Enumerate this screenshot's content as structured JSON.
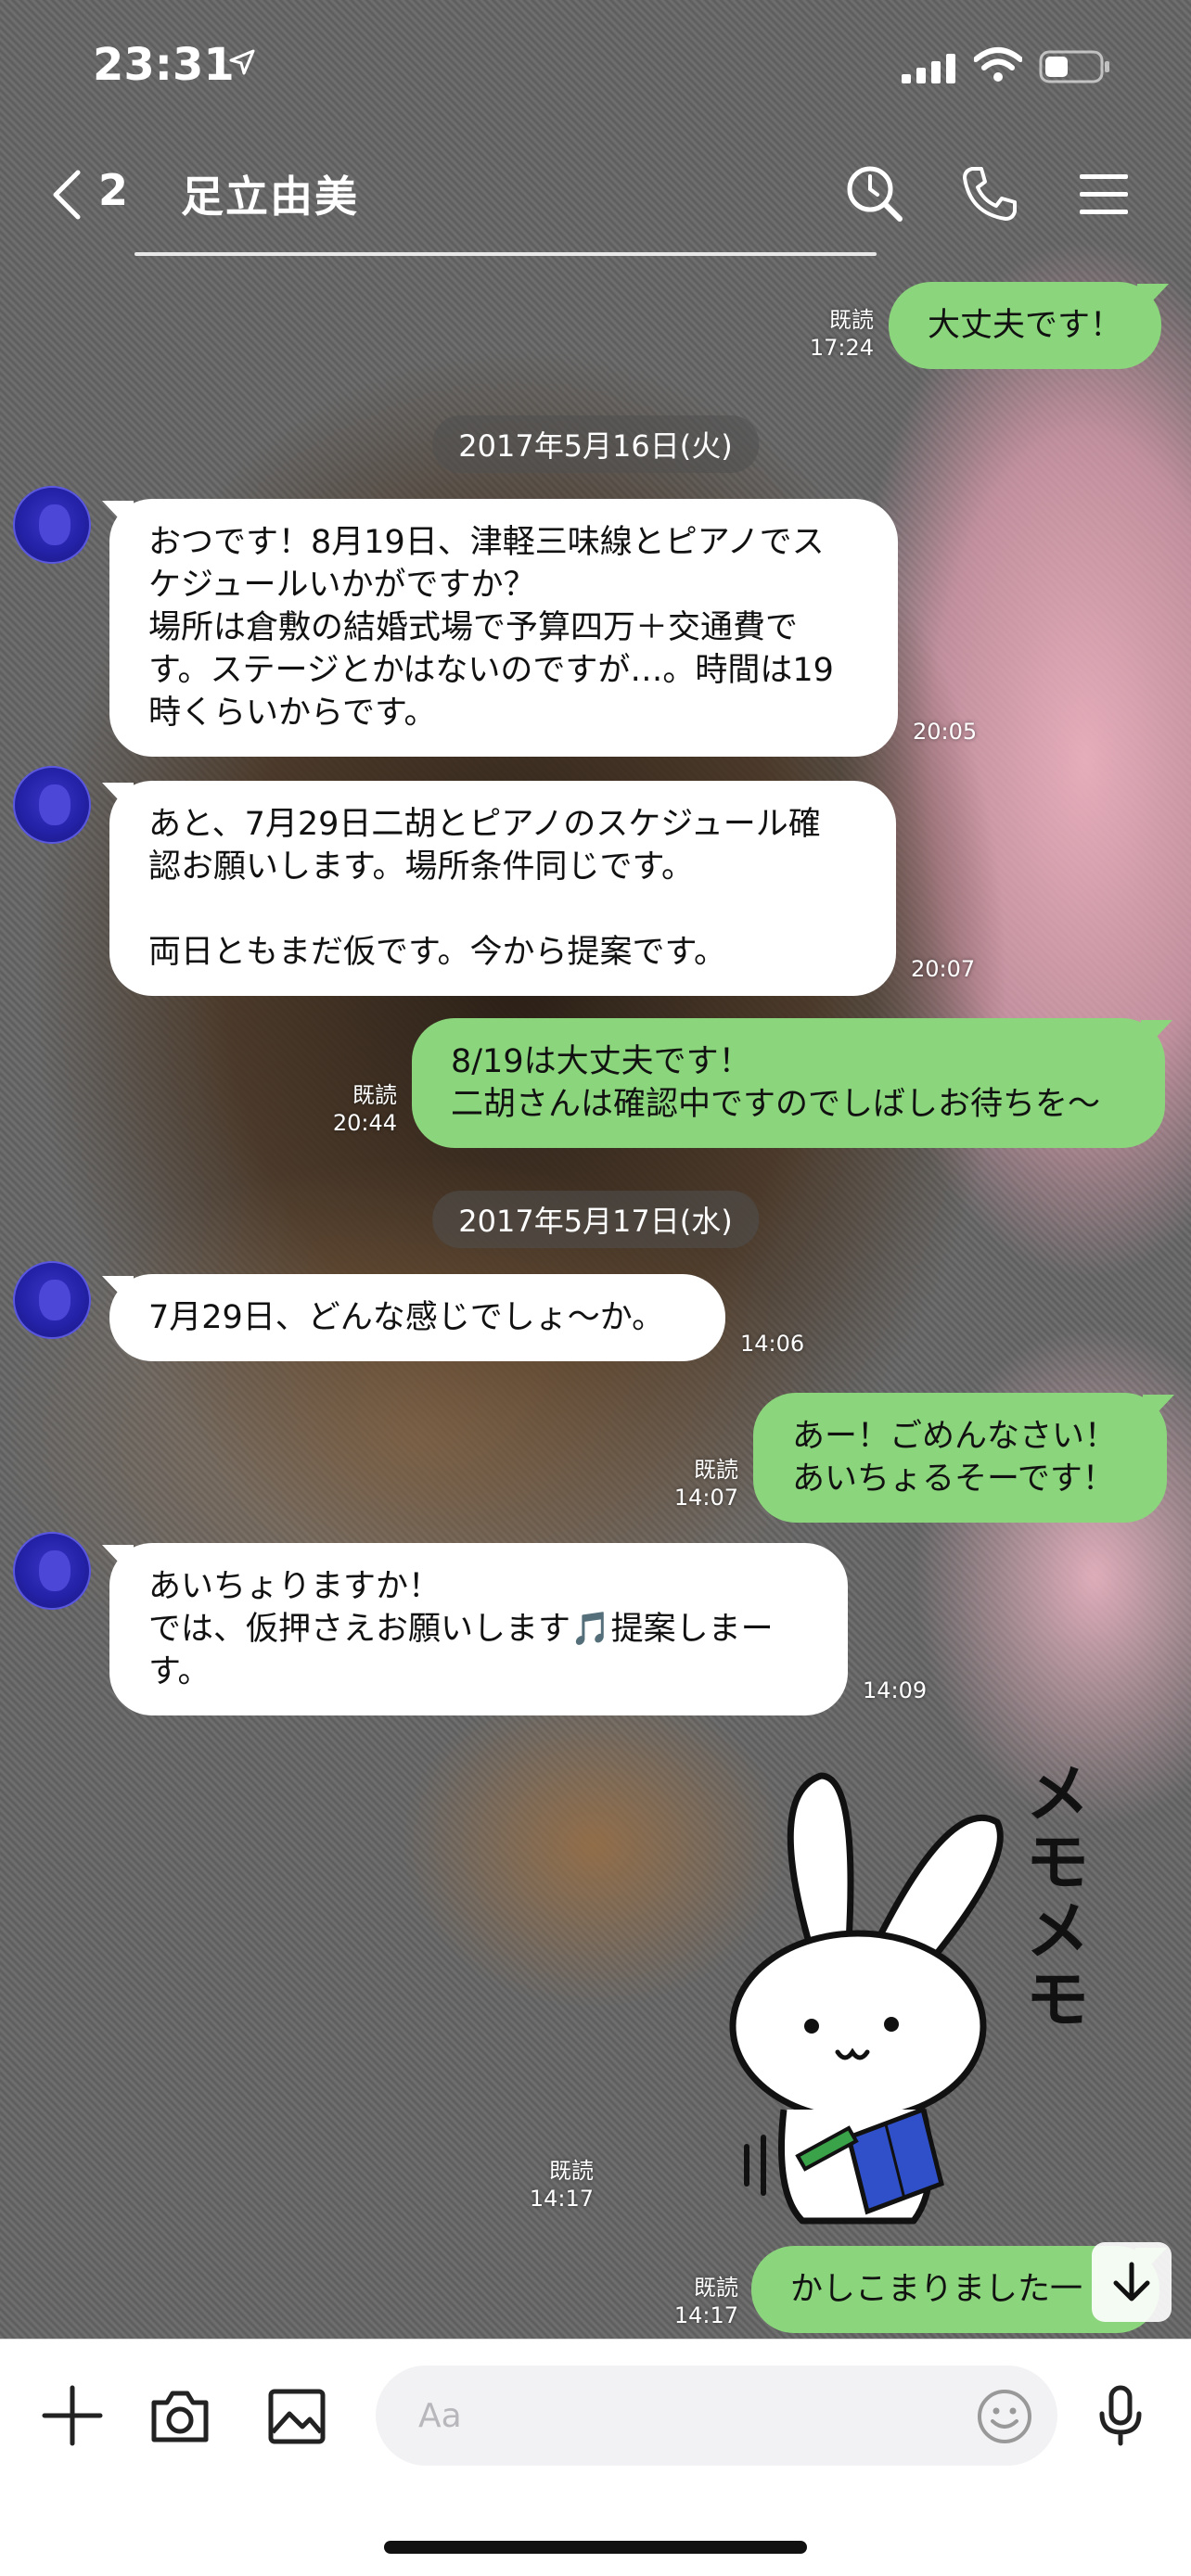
{
  "status_bar": {
    "time": "23:31"
  },
  "header": {
    "unread_count": "2",
    "title": "足立由美"
  },
  "messages": [
    {
      "text": "大丈夫です！",
      "read": "既読",
      "time": "17:24"
    },
    {
      "date": "2017年5月16日(火)"
    },
    {
      "text": "おつです！8月19日、津軽三味線とピアノでス\nケジュールいかがですか？\n場所は倉敷の結婚式場で予算四万＋交通費で\nす。ステージとかはないのですが…。時間は19\n時くらいからです。",
      "time": "20:05"
    },
    {
      "text": "あと、7月29日二胡とピアノのスケジュール確\n認お願いします。場所条件同じです。\n\n両日ともまだ仮です。今から提案です。",
      "time": "20:07"
    },
    {
      "text": "8/19は大丈夫です！\n二胡さんは確認中ですのでしばしお待ちを〜",
      "read": "既読",
      "time": "20:44"
    },
    {
      "date": "2017年5月17日(水)"
    },
    {
      "text": "7月29日、どんな感じでしょ〜か。",
      "time": "14:06"
    },
    {
      "text": "あー！ごめんなさい！\nあいちょるそーです！",
      "read": "既読",
      "time": "14:07"
    },
    {
      "text": "あいちょりますか！\nでは、仮押さえお願いします🎵提案しまー\nす。",
      "time": "14:09"
    },
    {
      "sticker_text": "メモメモ",
      "read": "既読",
      "time": "14:17"
    },
    {
      "text": "かしこまりました一",
      "read": "既読",
      "time": "14:17"
    }
  ],
  "input": {
    "placeholder": "Aa"
  },
  "colors": {
    "outgoing_bubble": "#8bd67c",
    "incoming_bubble": "#ffffff"
  }
}
